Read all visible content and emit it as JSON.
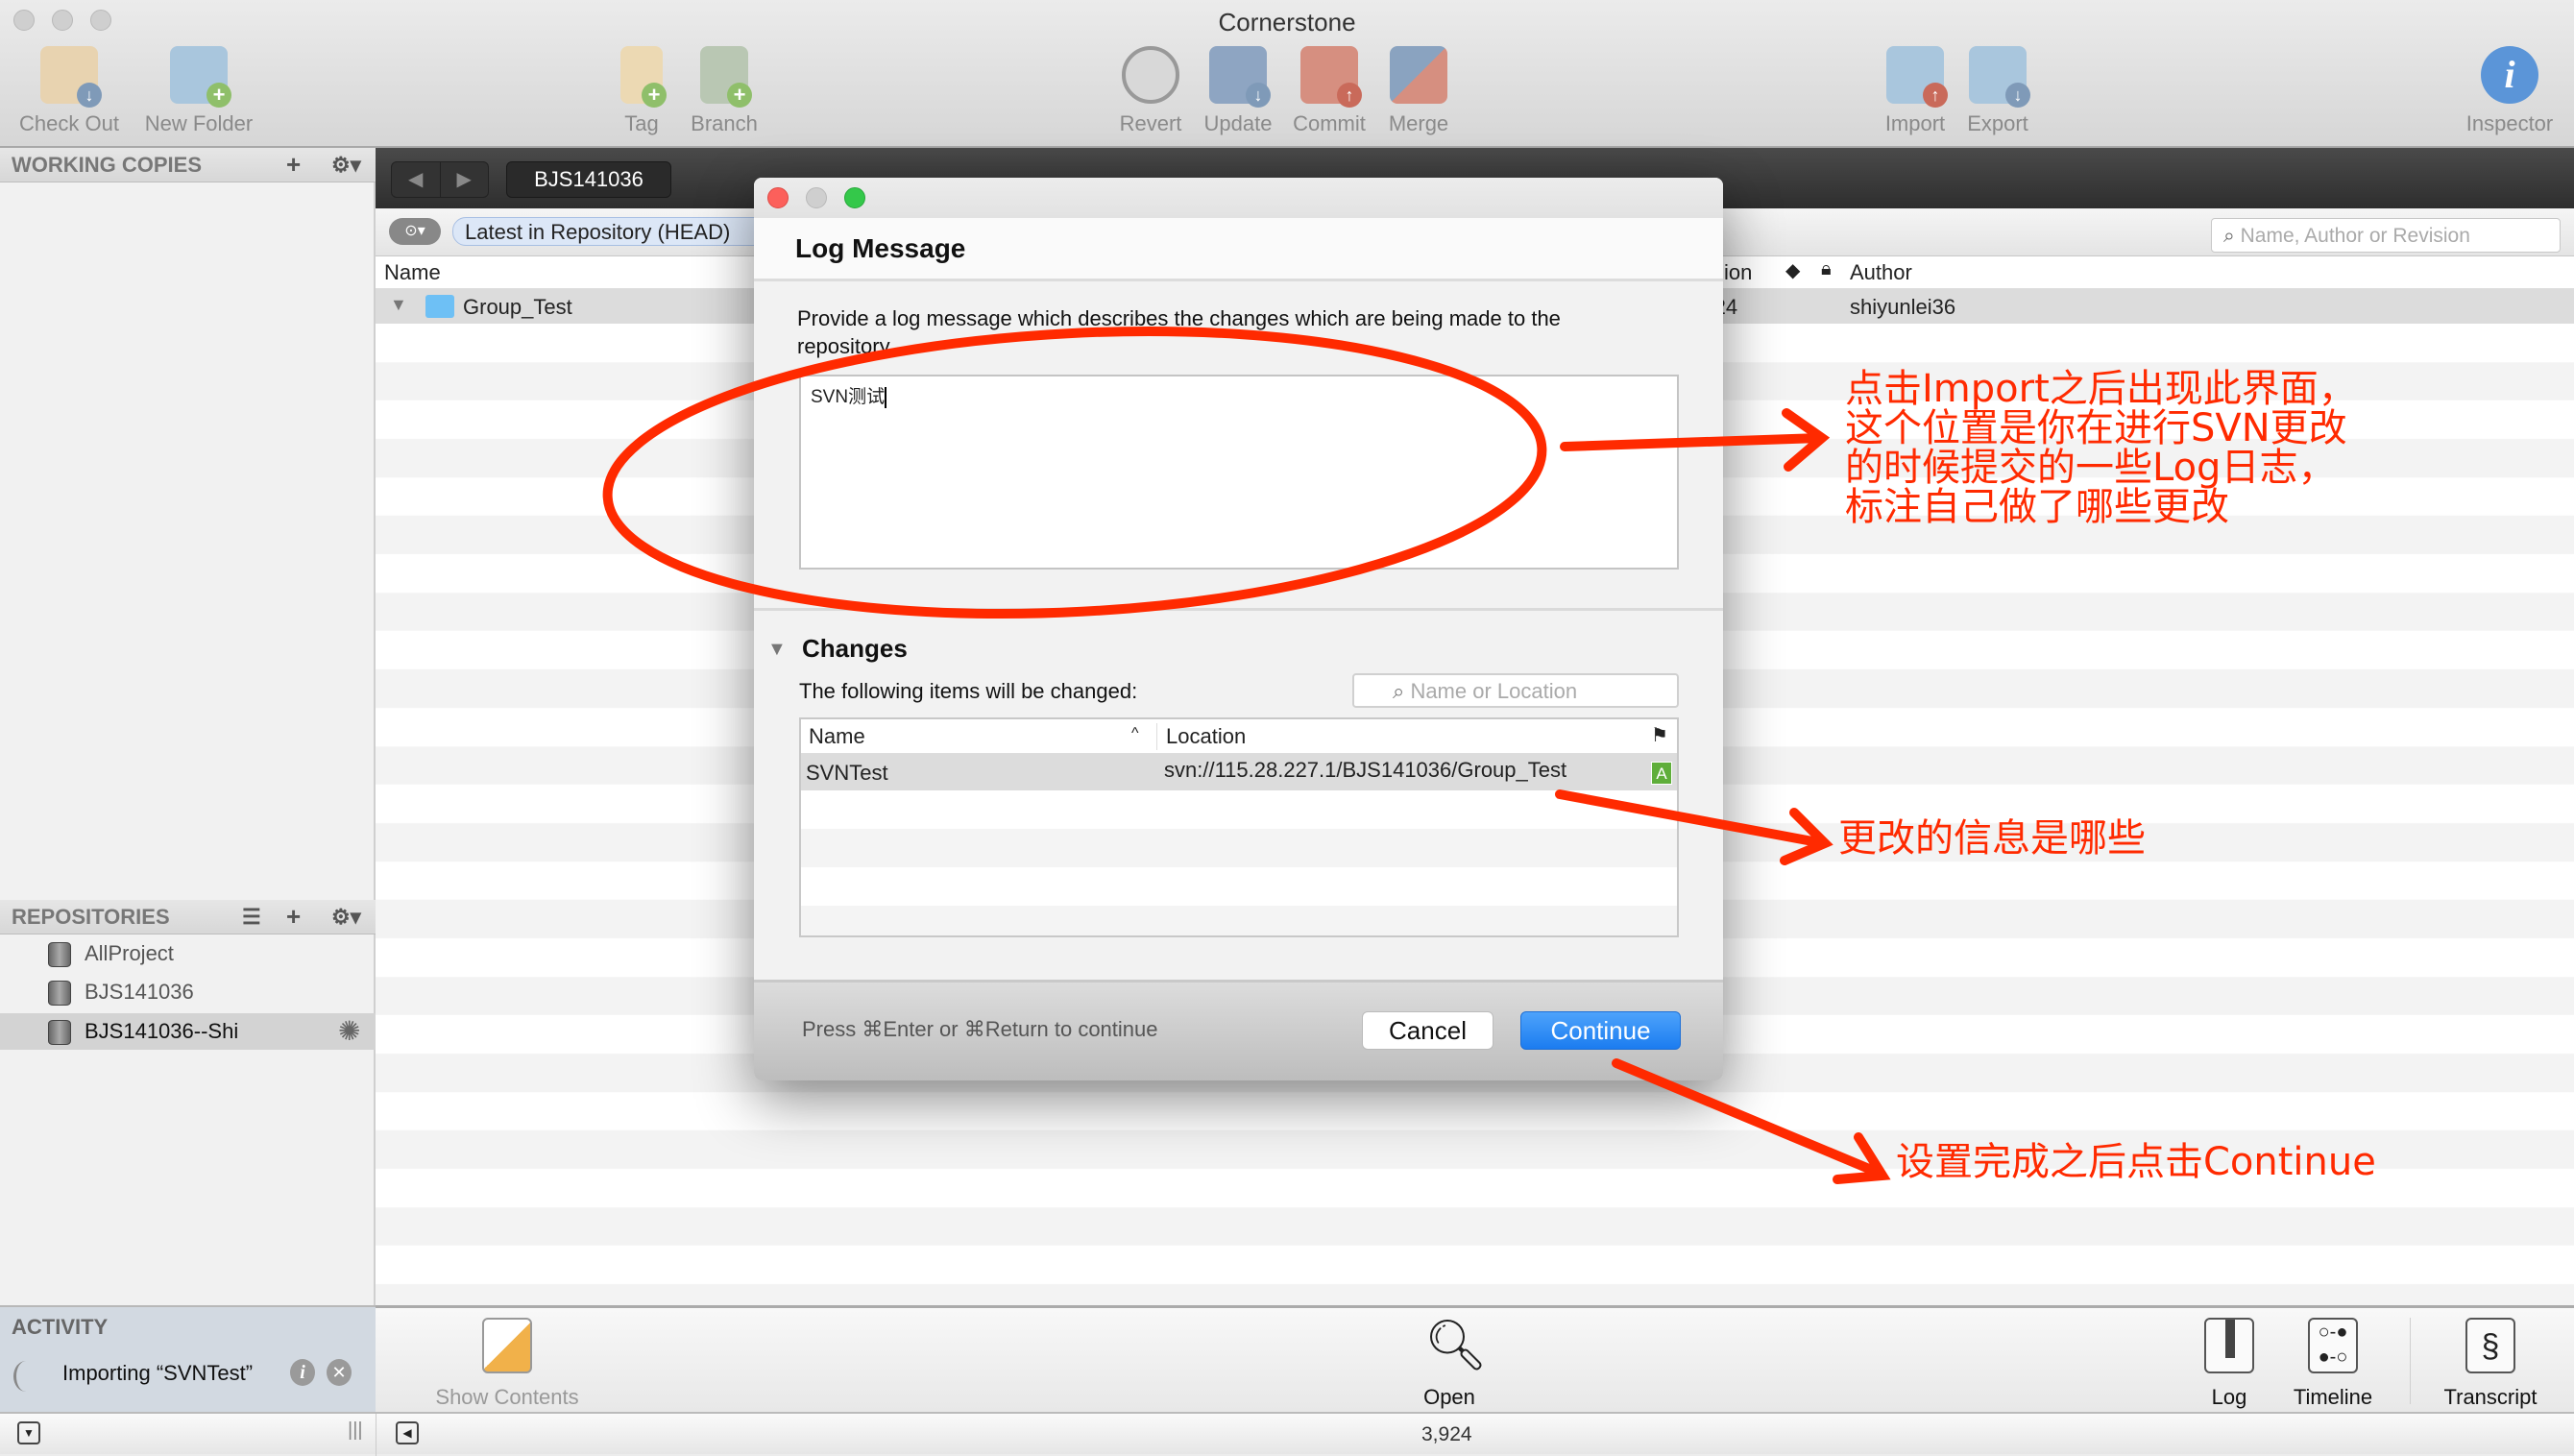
{
  "window": {
    "title": "Cornerstone"
  },
  "toolbar": {
    "items": [
      {
        "label": "Check Out",
        "icon": "checkout-icon"
      },
      {
        "label": "New Folder",
        "icon": "new-folder-icon"
      },
      {
        "label": "Tag",
        "icon": "tag-icon"
      },
      {
        "label": "Branch",
        "icon": "branch-icon"
      },
      {
        "label": "Revert",
        "icon": "revert-icon"
      },
      {
        "label": "Update",
        "icon": "update-icon"
      },
      {
        "label": "Commit",
        "icon": "commit-icon"
      },
      {
        "label": "Merge",
        "icon": "merge-icon"
      },
      {
        "label": "Import",
        "icon": "import-icon"
      },
      {
        "label": "Export",
        "icon": "export-icon"
      },
      {
        "label": "Inspector",
        "icon": "info-icon"
      }
    ]
  },
  "sidebar": {
    "working_copies": "WORKING COPIES",
    "repositories": "REPOSITORIES",
    "repos": [
      {
        "label": "AllProject"
      },
      {
        "label": "BJS141036"
      },
      {
        "label": "BJS141036--Shi",
        "selected": true
      }
    ],
    "activity": {
      "title": "ACTIVITY",
      "item": "Importing “SVNTest”"
    }
  },
  "main": {
    "repo_tab": "BJS141036",
    "revision_filter": "Latest in Repository (HEAD)",
    "search_placeholder": "Name, Author or Revision",
    "columns": {
      "name": "Name",
      "revision": "ion",
      "author": "Author"
    },
    "rows": [
      {
        "name": "Group_Test",
        "revision": "3,924",
        "author": "shiyunlei36"
      }
    ]
  },
  "bottom": {
    "show_contents": "Show Contents",
    "open": "Open",
    "log": "Log",
    "timeline": "Timeline",
    "transcript": "Transcript",
    "revision": "3,924"
  },
  "dialog": {
    "title": "Log Message",
    "prompt": "Provide a log message which describes the changes which are being made to the repository.",
    "message": "SVN测试",
    "changes_title": "Changes",
    "changes_desc": "The following items will be changed:",
    "filter_placeholder": "Name or Location",
    "columns": {
      "name": "Name",
      "location": "Location"
    },
    "items": [
      {
        "name": "SVNTest",
        "location": "svn://115.28.227.1/BJS141036/Group_Test",
        "status": "A"
      }
    ],
    "hint": "Press ⌘Enter or ⌘Return to continue",
    "cancel": "Cancel",
    "continue": "Continue"
  },
  "annotations": {
    "note1": [
      "点击Import之后出现此界面，",
      "这个位置是你在进行SVN更改",
      "的时候提交的一些Log日志，",
      "标注自己做了哪些更改"
    ],
    "note2": "更改的信息是哪些",
    "note3": "设置完成之后点击Continue",
    "color": "#ff2a00"
  },
  "colors": {
    "accent": "#2f8cf6",
    "close": "#fc605b",
    "zoom": "#34c84a"
  }
}
